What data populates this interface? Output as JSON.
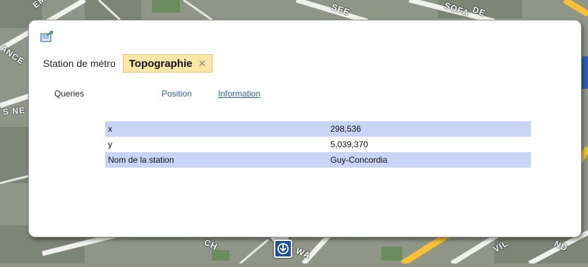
{
  "map": {
    "street_labels": [
      "EMM",
      "ANCE",
      "SEE",
      "SOFA",
      "DE",
      "S NE",
      "CH",
      "WA",
      "ND",
      "VIL"
    ]
  },
  "popup": {
    "export_icon": "export-icon",
    "layer_label": "Station de métro",
    "layer_tag": "Topographie",
    "layer_tag_close": "✕",
    "tabs": {
      "queries": "Queries",
      "position": "Position",
      "information": "Information"
    },
    "attributes": [
      {
        "name": "x",
        "value": "298,536"
      },
      {
        "name": "y",
        "value": "5,039,370"
      },
      {
        "name": "Nom de la station",
        "value": "Guy-Concordia"
      }
    ]
  },
  "colors": {
    "tab_link": "#2a5fa8",
    "row_highlight": "#c9d3f3",
    "tag_background": "#fde7a6",
    "metro_marker": "#1d4f9c"
  }
}
